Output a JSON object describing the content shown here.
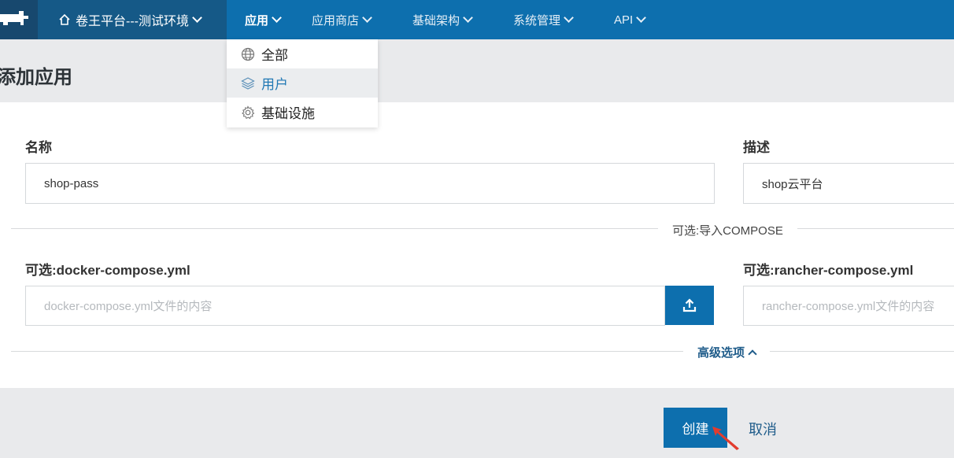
{
  "nav": {
    "environment": "卷王平台---测试环境",
    "items": [
      {
        "label": "应用",
        "active": true
      },
      {
        "label": "应用商店"
      },
      {
        "label": "基础架构"
      },
      {
        "label": "系统管理"
      },
      {
        "label": "API"
      }
    ]
  },
  "dropdown": {
    "items": [
      {
        "label": "全部",
        "icon": "globe-icon"
      },
      {
        "label": "用户",
        "icon": "layers-icon"
      },
      {
        "label": "基础设施",
        "icon": "gear-icon"
      }
    ]
  },
  "page": {
    "title": "添加应用"
  },
  "form": {
    "name_label": "名称",
    "name_value": "shop-pass",
    "desc_label": "描述",
    "desc_value": "shop云平台",
    "compose_divider": "可选:导入COMPOSE",
    "docker_label": "可选:docker-compose.yml",
    "docker_placeholder": "docker-compose.yml文件的内容",
    "rancher_label": "可选:rancher-compose.yml",
    "rancher_placeholder": "rancher-compose.yml文件的内容",
    "advanced": "高级选项"
  },
  "actions": {
    "create": "创建",
    "cancel": "取消"
  },
  "colors": {
    "nav": "#0d6fae",
    "env": "#155987",
    "primary": "#0d6fae",
    "link": "#1f5c8a"
  }
}
